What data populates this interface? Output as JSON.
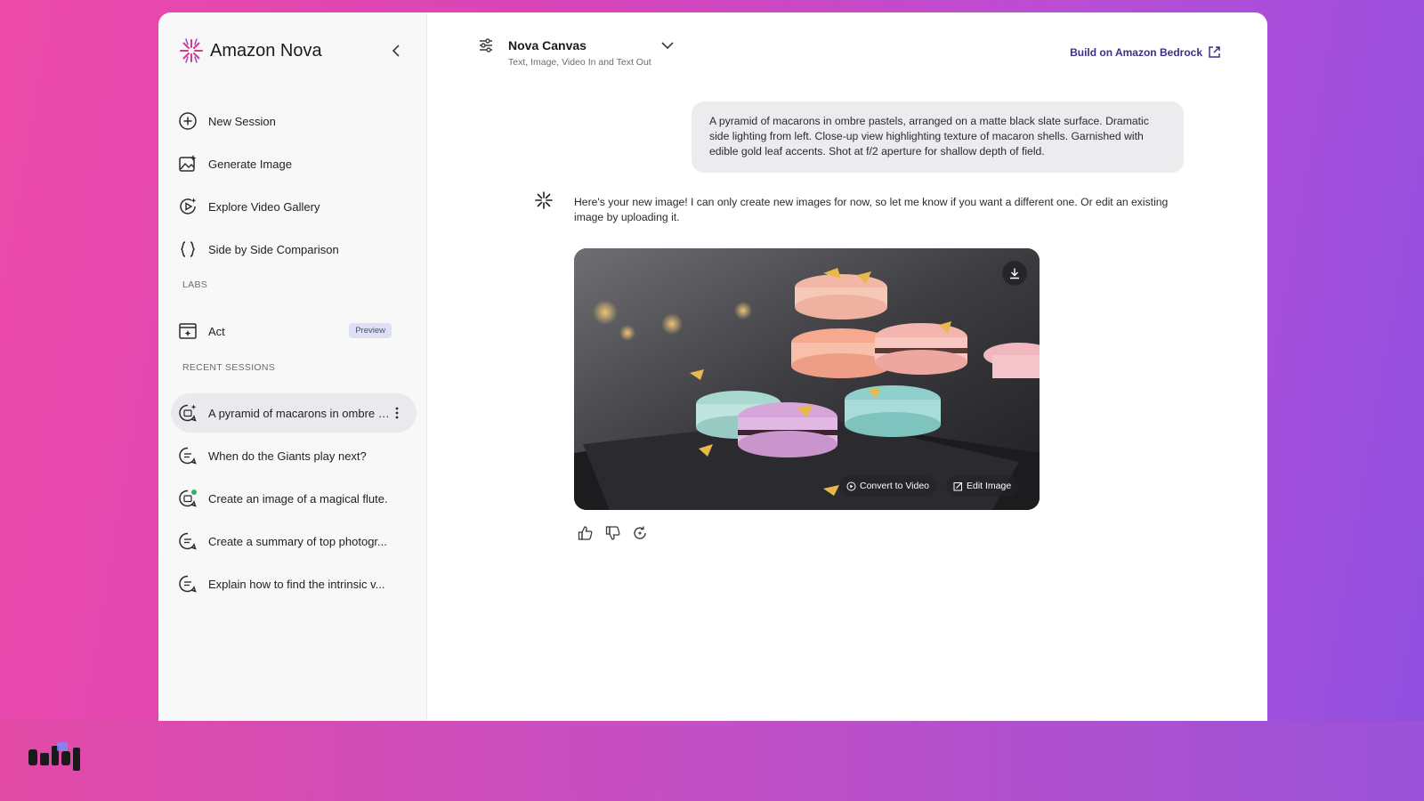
{
  "brand": {
    "name": "Amazon Nova"
  },
  "sidebar": {
    "items": [
      {
        "label": "New Session",
        "icon": "plus-circle-icon"
      },
      {
        "label": "Generate Image",
        "icon": "image-sparkle-icon"
      },
      {
        "label": "Explore Video Gallery",
        "icon": "video-play-icon"
      },
      {
        "label": "Side by Side Comparison",
        "icon": "braces-icon"
      }
    ],
    "labs_title": "LABS",
    "labs_items": [
      {
        "label": "Act",
        "badge": "Preview",
        "icon": "browser-window-icon"
      }
    ],
    "recent_title": "RECENT SESSIONS",
    "recent": [
      {
        "label": "A pyramid of macarons in ombre p..."
      },
      {
        "label": "When do the Giants play next?"
      },
      {
        "label": "Create an image of a magical flute."
      },
      {
        "label": "Create a summary of top photogr..."
      },
      {
        "label": "Explain how to find the intrinsic v..."
      }
    ]
  },
  "header": {
    "model_name": "Nova Canvas",
    "model_subtitle": "Text, Image, Video In and Text Out",
    "bedrock_link": "Build on Amazon Bedrock"
  },
  "chat": {
    "user_message": "A pyramid of macarons in ombre pastels, arranged on a matte black slate surface. Dramatic side lighting from left. Close-up view highlighting texture of macaron shells. Garnished with edible gold leaf accents. Shot at f/2 aperture for shallow depth of field.",
    "assistant_message": "Here's your new image! I can only create new images for now, so let me know if you want a different one. Or edit an existing image by uploading it.",
    "image_actions": {
      "convert": "Convert to Video",
      "edit": "Edit Image"
    }
  },
  "colors": {
    "accent": "#3d2f86",
    "brand_pink": "#d94aa8",
    "active_bg": "#e9e9ee",
    "badge_bg": "#dde0f2"
  }
}
